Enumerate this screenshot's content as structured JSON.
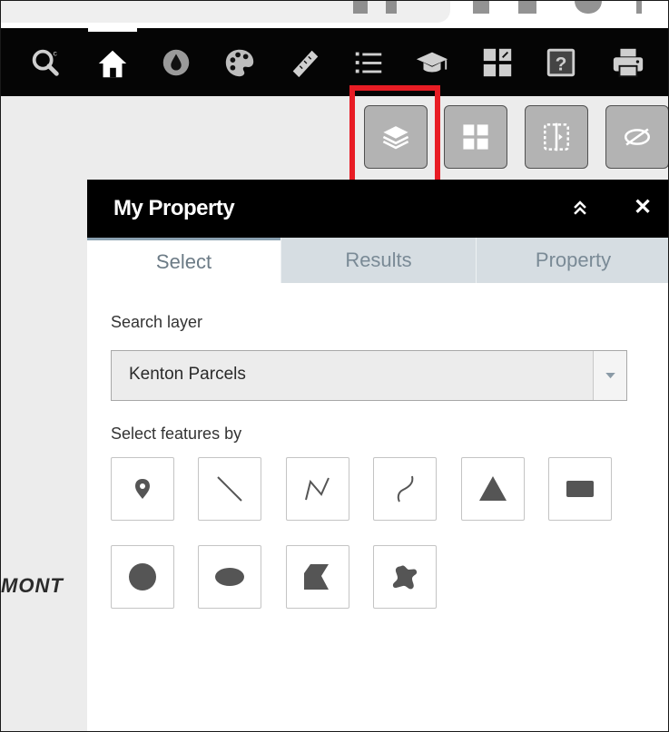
{
  "colors": {
    "toolbar_bg": "#050505",
    "highlight": "#e81c24",
    "tab_text": "#7a8a96",
    "icon_gray": "#555555"
  },
  "toolbar": {
    "tools": [
      {
        "name": "search-icon"
      },
      {
        "name": "home-icon"
      },
      {
        "name": "water-drop-icon"
      },
      {
        "name": "palette-icon"
      },
      {
        "name": "measure-ruler-icon"
      },
      {
        "name": "list-icon"
      },
      {
        "name": "graduation-cap-icon"
      },
      {
        "name": "grid-icon"
      },
      {
        "name": "help-icon"
      },
      {
        "name": "print-icon"
      }
    ]
  },
  "map": {
    "buttons": [
      {
        "name": "layers-icon"
      },
      {
        "name": "basemap-grid-icon"
      },
      {
        "name": "swipe-icon"
      },
      {
        "name": "eye-hidden-icon"
      }
    ],
    "partial_label": "MONT"
  },
  "panel": {
    "title": "My Property",
    "tabs": [
      {
        "label": "Select"
      },
      {
        "label": "Results"
      },
      {
        "label": "Property"
      }
    ],
    "search_layer_label": "Search layer",
    "search_layer_value": "Kenton Parcels",
    "select_by_label": "Select features by",
    "shape_tools": [
      {
        "name": "point-icon"
      },
      {
        "name": "line-icon"
      },
      {
        "name": "polyline-icon"
      },
      {
        "name": "freehand-line-icon"
      },
      {
        "name": "triangle-icon"
      },
      {
        "name": "rectangle-icon"
      },
      {
        "name": "circle-icon"
      },
      {
        "name": "ellipse-icon"
      },
      {
        "name": "polygon-icon"
      },
      {
        "name": "freehand-polygon-icon"
      }
    ]
  }
}
